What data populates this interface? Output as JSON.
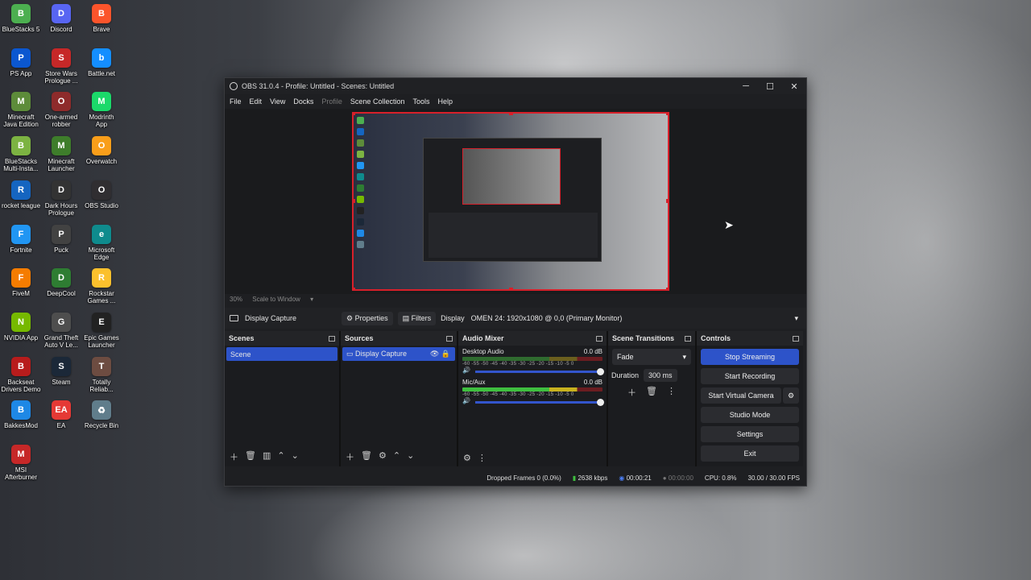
{
  "desktop": {
    "icons": [
      {
        "label": "BlueStacks 5",
        "glyph": "B",
        "color": "#4caf50"
      },
      {
        "label": "Discord",
        "glyph": "D",
        "color": "#5865f2"
      },
      {
        "label": "Brave",
        "glyph": "B",
        "color": "#fb542b"
      },
      {
        "label": "PS App",
        "glyph": "P",
        "color": "#0b57d0"
      },
      {
        "label": "Store Wars\nPrologue ...",
        "glyph": "S",
        "color": "#c62828"
      },
      {
        "label": "Battle.net",
        "glyph": "b",
        "color": "#148eff"
      },
      {
        "label": "Minecraft\nJava Edition",
        "glyph": "M",
        "color": "#5d8c3a"
      },
      {
        "label": "One-armed\nrobber",
        "glyph": "O",
        "color": "#8e2b2b"
      },
      {
        "label": "Modrinth\nApp",
        "glyph": "M",
        "color": "#1bd96a"
      },
      {
        "label": "BlueStacks\nMulti-Insta...",
        "glyph": "B",
        "color": "#7cb342"
      },
      {
        "label": "Minecraft\nLauncher",
        "glyph": "M",
        "color": "#3e7d2b"
      },
      {
        "label": "Overwatch",
        "glyph": "O",
        "color": "#f99e1a"
      },
      {
        "label": "rocket league",
        "glyph": "R",
        "color": "#1565c0"
      },
      {
        "label": "Dark Hours\nPrologue",
        "glyph": "D",
        "color": "#333333"
      },
      {
        "label": "OBS Studio",
        "glyph": "O",
        "color": "#302e31"
      },
      {
        "label": "Fortnite",
        "glyph": "F",
        "color": "#2196f3"
      },
      {
        "label": "Puck",
        "glyph": "P",
        "color": "#424242"
      },
      {
        "label": "Microsoft\nEdge",
        "glyph": "e",
        "color": "#0f8b8d"
      },
      {
        "label": "FiveM",
        "glyph": "F",
        "color": "#f57c00"
      },
      {
        "label": "DeepCool",
        "glyph": "D",
        "color": "#2e7d32"
      },
      {
        "label": "Rockstar\nGames ...",
        "glyph": "R",
        "color": "#fbc02d"
      },
      {
        "label": "NVIDIA App",
        "glyph": "N",
        "color": "#76b900"
      },
      {
        "label": "Grand Theft\nAuto V Le...",
        "glyph": "G",
        "color": "#4e4e4e"
      },
      {
        "label": "Epic Games\nLauncher",
        "glyph": "E",
        "color": "#222222"
      },
      {
        "label": "Backseat\nDrivers Demo",
        "glyph": "B",
        "color": "#b71c1c"
      },
      {
        "label": "Steam",
        "glyph": "S",
        "color": "#1b2838"
      },
      {
        "label": "Totally\nReliab...",
        "glyph": "T",
        "color": "#6d4c41"
      },
      {
        "label": "BakkesMod",
        "glyph": "B",
        "color": "#1e88e5"
      },
      {
        "label": "EA",
        "glyph": "EA",
        "color": "#e53935"
      },
      {
        "label": "Recycle Bin",
        "glyph": "♻",
        "color": "#607d8b"
      },
      {
        "label": "MSI\nAfterburner",
        "glyph": "M",
        "color": "#c62828"
      }
    ]
  },
  "window": {
    "title": "OBS 31.0.4 - Profile: Untitled - Scenes: Untitled",
    "minimize": "─",
    "maximize": "☐",
    "close": "✕"
  },
  "menu": {
    "file": "File",
    "edit": "Edit",
    "view": "View",
    "docks": "Docks",
    "profile": "Profile",
    "scene_collection": "Scene Collection",
    "tools": "Tools",
    "help": "Help"
  },
  "preview": {
    "zoom": "30%",
    "scale_mode": "Scale to Window"
  },
  "source_toolbar": {
    "source_name": "Display Capture",
    "properties": "Properties",
    "filters": "Filters",
    "display_label": "Display",
    "display_value": "OMEN 24: 1920x1080 @ 0,0 (Primary Monitor)"
  },
  "scenes": {
    "header": "Scenes",
    "items": [
      "Scene"
    ]
  },
  "sources": {
    "header": "Sources",
    "items": [
      "Display Capture"
    ]
  },
  "mixer": {
    "header": "Audio Mixer",
    "channels": [
      {
        "name": "Desktop Audio",
        "level": "0.0 dB"
      },
      {
        "name": "Mic/Aux",
        "level": "0.0 dB"
      }
    ],
    "ticks": "-60 -55 -50 -45 -40 -35 -30 -25 -20 -15 -10 -5 0"
  },
  "transitions": {
    "header": "Scene Transitions",
    "type": "Fade",
    "duration_label": "Duration",
    "duration_value": "300 ms"
  },
  "controls": {
    "header": "Controls",
    "stop_streaming": "Stop Streaming",
    "start_recording": "Start Recording",
    "start_virtual_camera": "Start Virtual Camera",
    "studio_mode": "Studio Mode",
    "settings": "Settings",
    "exit": "Exit"
  },
  "status": {
    "dropped_frames": "Dropped Frames 0 (0.0%)",
    "bitrate": "2638 kbps",
    "stream_time": "00:00:21",
    "record_time": "00:00:00",
    "cpu": "CPU: 0.8%",
    "fps": "30.00 / 30.00 FPS"
  },
  "colors": {
    "accent": "#2d53c9",
    "selection_border": "#d8202a",
    "meter_green": "#3fbf3f",
    "meter_yellow": "#c8b21e",
    "meter_red": "#c0262c"
  }
}
